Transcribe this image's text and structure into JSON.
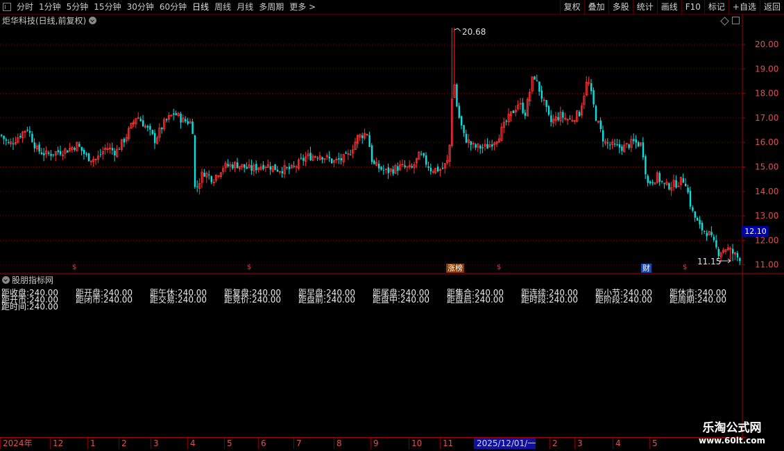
{
  "toolbar": {
    "periods": [
      "分时",
      "1分钟",
      "5分钟",
      "15分钟",
      "30分钟",
      "60分钟",
      "日线",
      "周线",
      "月线",
      "多周期",
      "更多 >"
    ],
    "active_period": "日线",
    "right_buttons": [
      "复权",
      "叠加",
      "多股",
      "统计",
      "画线",
      "F10",
      "标记",
      "+自选",
      "返回"
    ]
  },
  "chart": {
    "title": "炬华科技(日线,前复权)",
    "y_ticks": [
      "20.00",
      "19.00",
      "18.00",
      "17.00",
      "16.00",
      "15.00",
      "14.00",
      "13.00",
      "12.00",
      "11.00"
    ],
    "high_label": "20.68",
    "low_label": "11.15",
    "last_price": "12.10",
    "event_markers": [
      {
        "label": "$",
        "type": "dividend"
      },
      {
        "label": "$",
        "type": "dividend"
      },
      {
        "label": "涨榜",
        "type": "limit-up-list"
      },
      {
        "label": "$",
        "type": "dividend"
      },
      {
        "label": "财",
        "type": "financial-report"
      },
      {
        "label": "$",
        "type": "dividend"
      }
    ],
    "colors": {
      "up": "#ff3232",
      "down": "#00e4e4",
      "grid": "#7a0000",
      "price_tag": "#0000a8"
    }
  },
  "indicator": {
    "title": "股朋指标网",
    "rows": [
      [
        "距收盘:240.00",
        "距开盘:240.00",
        "距午休:240.00",
        "距复盘:240.00",
        "距早盘:240.00",
        "距尾盘:240.00",
        "距集合:240.00",
        "距连续:240.00",
        "距小节:240.00",
        "距休市:240.00"
      ],
      [
        "距开市:240.00",
        "距闭市:240.00",
        "距交易:240.00",
        "距竞价:240.00",
        "距盘前:240.00",
        "距盘中:240.00",
        "距盘启:240.00",
        "距时段:240.00",
        "距阶段:240.00",
        "距周期:240.00"
      ],
      [
        "距时间:240.00"
      ]
    ]
  },
  "xaxis": {
    "labels": [
      "2024年",
      "12",
      "1",
      "2",
      "3",
      "4",
      "5",
      "6",
      "7",
      "8",
      "9",
      "10",
      "11",
      "2025/12/01/一",
      "2",
      "3",
      "4",
      "5"
    ]
  },
  "watermark": {
    "title": "乐淘公式网",
    "url": "www.60lt.com"
  }
}
